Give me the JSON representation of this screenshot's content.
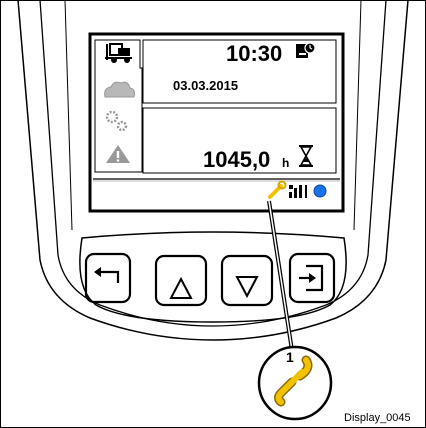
{
  "display": {
    "time": "10:30",
    "date": "03.03.2015",
    "operating_hours": "1045,0",
    "hours_unit": "h"
  },
  "callout": {
    "number": "1"
  },
  "figure_id": "Display_0045",
  "icons": {
    "sidebar": [
      "forklift-icon",
      "cloud-icon",
      "gears-icon",
      "warning-icon"
    ],
    "panel": [
      "clock-settings-icon",
      "hourglass-icon"
    ],
    "status_bar": [
      "maintenance-wrench-icon",
      "signal-bars-icon",
      "status-dot-icon"
    ],
    "buttons": [
      "back-arrow-icon",
      "up-triangle-icon",
      "down-triangle-icon",
      "enter-icon"
    ]
  },
  "colors": {
    "status_dot": "#1a73e8",
    "wrench": "#f2c200"
  }
}
